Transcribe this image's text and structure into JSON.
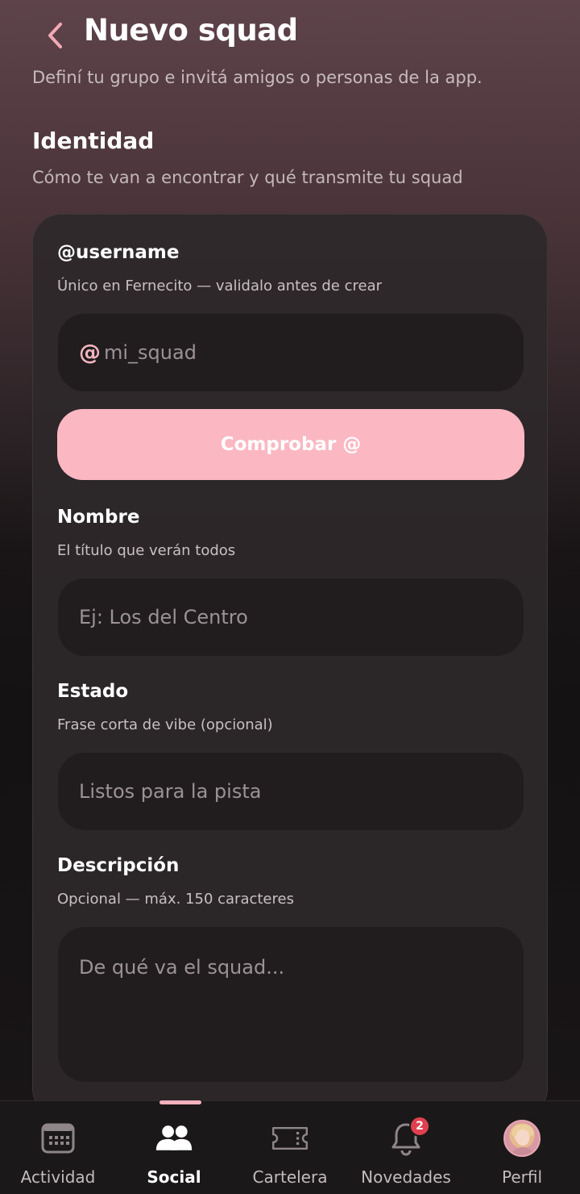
{
  "header": {
    "title": "Nuevo squad",
    "subtitle": "Definí tu grupo e invitá amigos o personas de la app."
  },
  "section": {
    "title": "Identidad",
    "subtitle": "Cómo te van a encontrar y qué transmite tu squad"
  },
  "form": {
    "username": {
      "label": "@username",
      "hint": "Único en Fernecito — validalo antes de crear",
      "prefix": "@",
      "placeholder": "mi_squad",
      "button": "Comprobar @"
    },
    "name": {
      "label": "Nombre",
      "hint": "El título que verán todos",
      "placeholder": "Ej: Los del Centro"
    },
    "status": {
      "label": "Estado",
      "hint": "Frase corta de vibe (opcional)",
      "placeholder": "Listos para la pista"
    },
    "description": {
      "label": "Descripción",
      "hint": "Opcional — máx. 150 caracteres",
      "placeholder": "De qué va el squad..."
    }
  },
  "nav": {
    "active": "Social",
    "items": [
      {
        "label": "Actividad",
        "icon": "calendar-icon"
      },
      {
        "label": "Social",
        "icon": "people-icon"
      },
      {
        "label": "Cartelera",
        "icon": "ticket-icon"
      },
      {
        "label": "Novedades",
        "icon": "bell-icon",
        "badge": "2"
      },
      {
        "label": "Perfil",
        "icon": "avatar"
      }
    ]
  },
  "colors": {
    "accent": "#fbb8c2",
    "badge": "#e04050"
  }
}
